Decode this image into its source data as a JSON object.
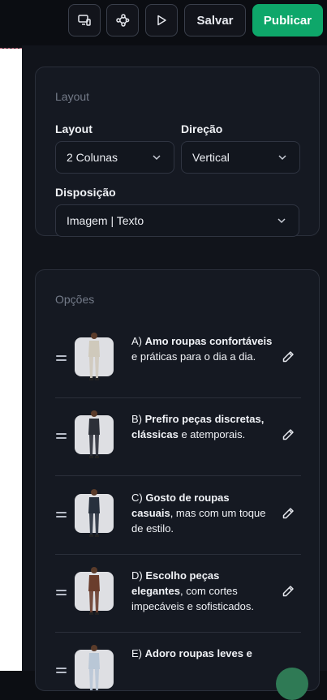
{
  "toolbar": {
    "icons": [
      "device-preview-icon",
      "flow-icon",
      "play-icon"
    ],
    "save_label": "Salvar",
    "publish_label": "Publicar"
  },
  "layout_card": {
    "title": "Layout",
    "layout": {
      "label": "Layout",
      "value": "2 Colunas"
    },
    "direction": {
      "label": "Direção",
      "value": "Vertical"
    },
    "disposition": {
      "label": "Disposição",
      "value": "Imagem | Texto"
    }
  },
  "options_card": {
    "title": "Opções",
    "items": [
      {
        "prefix": "A) ",
        "bold": "Amo roupas confortáveis",
        "rest": " e práticas para o dia a dia.",
        "outfit": "#cfc9bb"
      },
      {
        "prefix": "B) ",
        "bold": "Prefiro peças discretas, clássicas",
        "rest": " e atemporais.",
        "outfit": "#2c3038"
      },
      {
        "prefix": "C) ",
        "bold": "Gosto de roupas casuais",
        "rest": ", mas com um toque de estilo.",
        "outfit": "#27303d"
      },
      {
        "prefix": "D) ",
        "bold": "Escolho peças elegantes",
        "rest": ", com cortes impecáveis e sofisticados.",
        "outfit": "#6a3d2c"
      },
      {
        "prefix": "E) ",
        "bold": "Adoro roupas leves e",
        "rest": "",
        "outfit": "#b9c7d6"
      }
    ]
  }
}
